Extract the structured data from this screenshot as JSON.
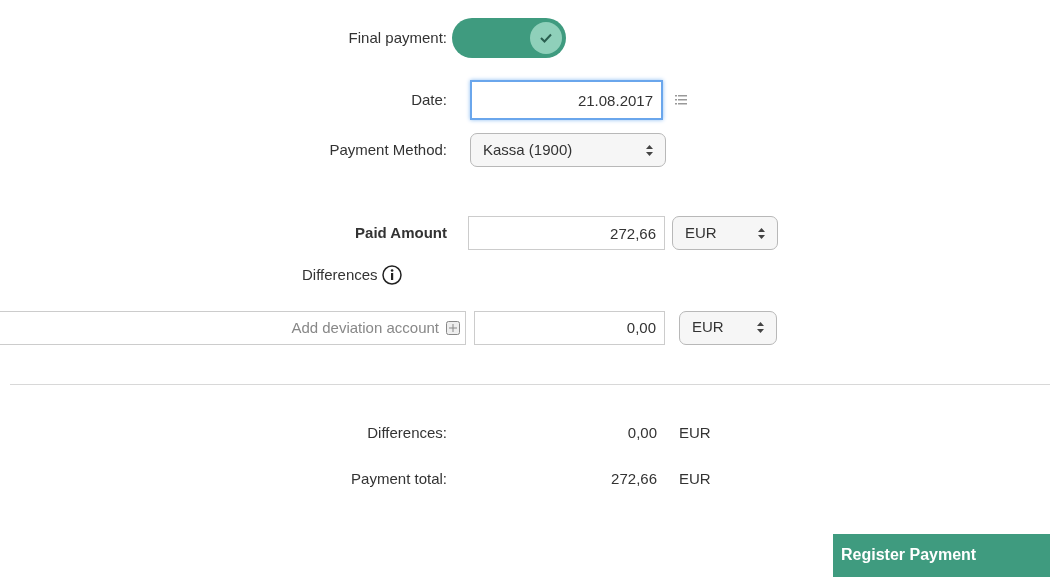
{
  "final_payment": {
    "label": "Final payment:",
    "on": true
  },
  "date": {
    "label": "Date:",
    "value": "21.08.2017",
    "focused": true
  },
  "payment_method": {
    "label": "Payment Method:",
    "value": "Kassa (1900)"
  },
  "paid_amount": {
    "label": "Paid Amount",
    "value": "272,66",
    "currency": "EUR"
  },
  "differences_heading": "Differences",
  "deviation": {
    "placeholder": "Add deviation account",
    "value": "0,00",
    "currency": "EUR"
  },
  "summary": [
    {
      "label": "Differences:",
      "value": "0,00",
      "currency": "EUR"
    },
    {
      "label": "Payment total:",
      "value": "272,66",
      "currency": "EUR"
    }
  ],
  "submit": "Register Payment"
}
